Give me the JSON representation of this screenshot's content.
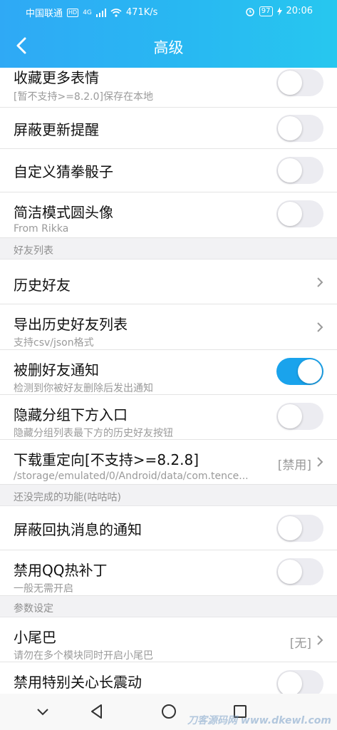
{
  "status_bar": {
    "carrier": "中国联通",
    "hd_badge": "HD",
    "network": "4G",
    "speed": "471K/s",
    "battery": "97",
    "time": "20:06"
  },
  "header": {
    "title": "高级"
  },
  "rows": {
    "collect_emoji": {
      "title": "收藏更多表情",
      "subtitle": "[暂不支持>=8.2.0]保存在本地",
      "on": false
    },
    "block_update": {
      "title": "屏蔽更新提醒",
      "on": false
    },
    "custom_dice": {
      "title": "自定义猜拳骰子",
      "on": false
    },
    "simple_avatar": {
      "title": "简洁模式圆头像",
      "subtitle": "From Rikka",
      "on": false
    },
    "history_friends": {
      "title": "历史好友"
    },
    "export_friends": {
      "title": "导出历史好友列表",
      "subtitle": "支持csv/json格式"
    },
    "deleted_notify": {
      "title": "被删好友通知",
      "subtitle": "检测到你被好友删除后发出通知",
      "on": true
    },
    "hide_group_entry": {
      "title": "隐藏分组下方入口",
      "subtitle": "隐藏分组列表最下方的历史好友按钮",
      "on": false
    },
    "download_redirect": {
      "title": "下载重定向[不支持>=8.2.8]",
      "subtitle": "/storage/emulated/0/Android/data/com.tence...",
      "value": "[禁用]"
    },
    "block_receipt": {
      "title": "屏蔽回执消息的通知",
      "on": false
    },
    "disable_hotpatch": {
      "title": "禁用QQ热补丁",
      "subtitle": "一般无需开启",
      "on": false
    },
    "tail": {
      "title": "小尾巴",
      "subtitle": "请勿在多个模块同时开启小尾巴",
      "value": "[无]"
    },
    "disable_vibrate": {
      "title": "禁用特别关心长震动",
      "on": false
    }
  },
  "sections": {
    "friends": "好友列表",
    "unfinished": "还没完成的功能(咕咕咕)",
    "params": "参数设定"
  },
  "icons": {
    "back": "chevron-left-icon",
    "chevron": "chevron-right-icon",
    "nav_down": "chevron-down-icon",
    "nav_back": "triangle-back-icon",
    "nav_home": "circle-home-icon",
    "nav_recent": "square-recent-icon"
  },
  "colors": {
    "accent": "#1aa3ec",
    "header_start": "#2fa9f5",
    "header_end": "#27c7ef"
  },
  "watermark": "刀客源码网 www.dkewl.com"
}
